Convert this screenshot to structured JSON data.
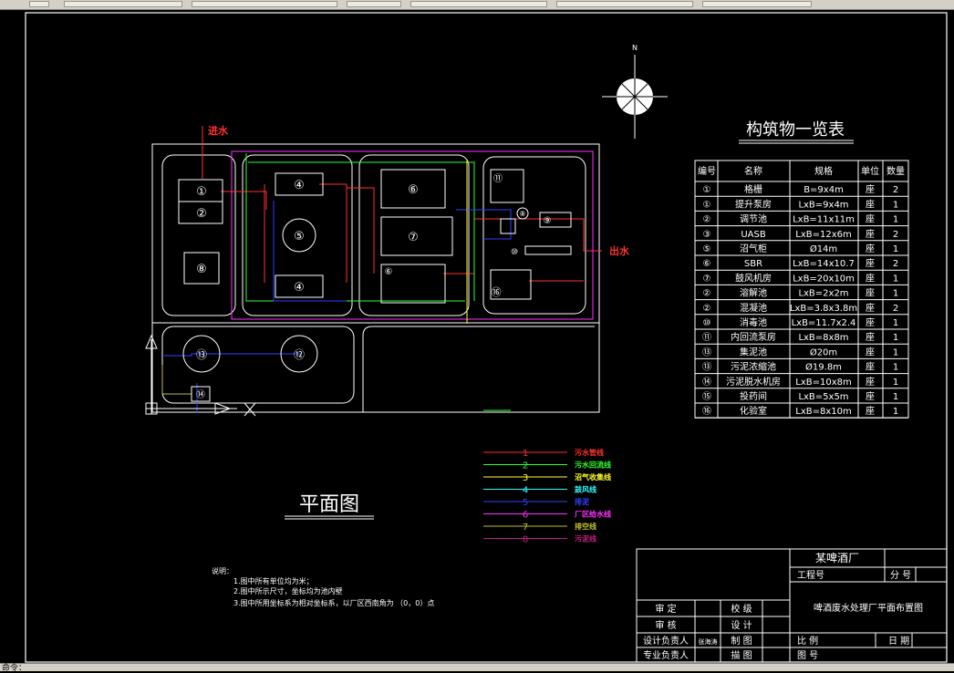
{
  "compass": {
    "north_label": "N"
  },
  "markers": {
    "inlet": "进水",
    "outlet": "出水"
  },
  "units_numbers": [
    "①",
    "②",
    "⑧",
    "④",
    "⑤",
    "④",
    "⑥",
    "⑦",
    "⑥",
    "⑪",
    "⑧",
    "⑨",
    "⑩",
    "⑯",
    "⑬",
    "⑫",
    "⑭"
  ],
  "table": {
    "title": "构筑物一览表",
    "headers": [
      "编号",
      "名称",
      "规格",
      "单位",
      "数量"
    ],
    "rows": [
      [
        "①",
        "格栅",
        "B=9x4m",
        "座",
        "2"
      ],
      [
        "①",
        "提升泵房",
        "LxB=9x4m",
        "座",
        "1"
      ],
      [
        "②",
        "调节池",
        "LxB=11x11m",
        "座",
        "1"
      ],
      [
        "③",
        "UASB",
        "LxB=12x6m",
        "座",
        "2"
      ],
      [
        "⑤",
        "沼气柜",
        "Ø14m",
        "座",
        "1"
      ],
      [
        "⑥",
        "SBR",
        "LxB=14x10.7",
        "座",
        "2"
      ],
      [
        "⑦",
        "鼓风机房",
        "LxB=20x10m",
        "座",
        "1"
      ],
      [
        "②",
        "溶解池",
        "LxB=2x2m",
        "座",
        "1"
      ],
      [
        "②",
        "混凝池",
        "LxB=3.8x3.8m",
        "座",
        "2"
      ],
      [
        "⑩",
        "消毒池",
        "LxB=11.7x2.4",
        "座",
        "1"
      ],
      [
        "⑪",
        "内回流泵房",
        "LxB=8x8m",
        "座",
        "1"
      ],
      [
        "⑬",
        "集泥池",
        "Ø20m",
        "座",
        "1"
      ],
      [
        "⑬",
        "污泥浓缩池",
        "Ø19.8m",
        "座",
        "1"
      ],
      [
        "⑭",
        "污泥脱水机房",
        "LxB=10x8m",
        "座",
        "1"
      ],
      [
        "⑮",
        "投药间",
        "LxB=5x5m",
        "座",
        "1"
      ],
      [
        "⑯",
        "化验室",
        "LxB=8x10m",
        "座",
        "1"
      ]
    ]
  },
  "legend": [
    {
      "num": "1",
      "label": "污水管线",
      "color": "#ff3030"
    },
    {
      "num": "2",
      "label": "污水回流线",
      "color": "#30ff30"
    },
    {
      "num": "3",
      "label": "沼气收集线",
      "color": "#ffff30"
    },
    {
      "num": "4",
      "label": "鼓风线",
      "color": "#30ffff"
    },
    {
      "num": "5",
      "label": "排泥",
      "color": "#3040ff"
    },
    {
      "num": "6",
      "label": "厂区给水线",
      "color": "#ff30ff"
    },
    {
      "num": "7",
      "label": "排空线",
      "color": "#c0c030"
    },
    {
      "num": "8",
      "label": "污泥线",
      "color": "#c02080"
    }
  ],
  "plan_title": "平面图",
  "notes": {
    "heading": "说明：",
    "lines": [
      "1.图中所有单位均为米；",
      "2.图中所示尺寸，坐标均为池内壁",
      "3.图中所用坐标系为相对坐标系，以厂区西南角为 （0，0）点"
    ]
  },
  "title_block": {
    "company": "某啤酒厂",
    "project_no_label": "工程号",
    "sub_no_label": "分 号",
    "drawing_title": "啤酒废水处理厂平面布置图",
    "approve": "审 定",
    "proofread": "校 级",
    "review": "审 核",
    "design": "设 计",
    "design_lead": "设计负责人",
    "design_lead_sign": "张海涛",
    "draw": "制 图",
    "discipline_lead": "专业负责人",
    "trace": "描 图",
    "scale": "比 例",
    "date": "日 期",
    "drawing_no": "图 号"
  },
  "status": {
    "text": "命令："
  }
}
